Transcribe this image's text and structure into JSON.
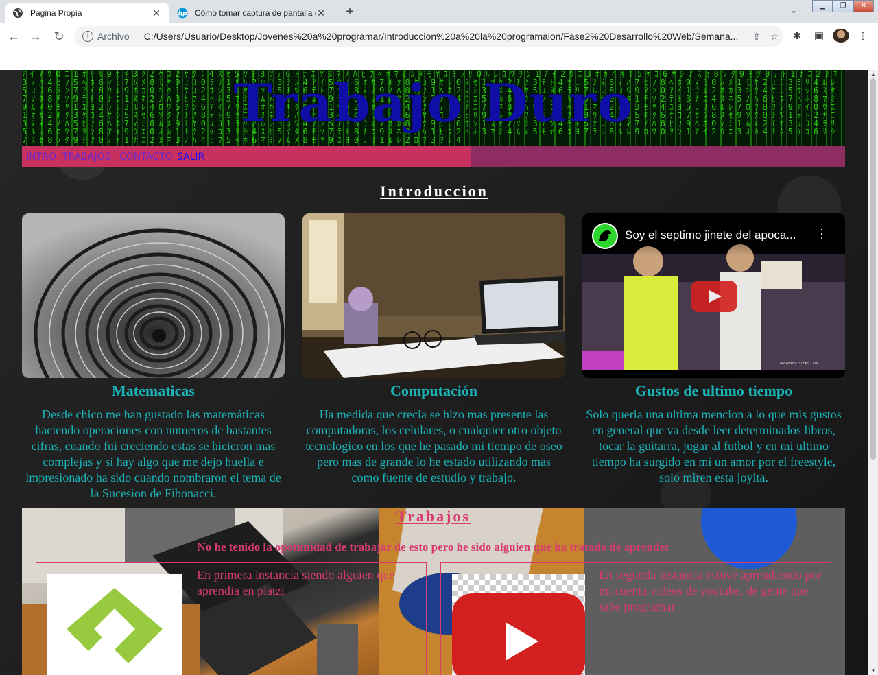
{
  "browser": {
    "tabs": [
      {
        "title": "Pagina Propia",
        "active": true
      },
      {
        "title": "Cómo tomar captura de pantalla (Sc",
        "active": false
      }
    ],
    "address_scheme": "Archivo",
    "address_url": "C:/Users/Usuario/Desktop/Jovenes%20a%20programar/Introduccion%20a%20la%20programaion/Fase2%20Desarrollo%20Web/Semana..."
  },
  "site": {
    "title": "Trabajo Duro",
    "menu": [
      "INTRO",
      "TRABAJOS",
      "CONTACTO",
      "SALIR"
    ]
  },
  "intro": {
    "heading": "Introduccion",
    "cards": [
      {
        "title": "Matematicas",
        "text": "Desde chico me han gustado las matemáticas haciendo operaciones con numeros de bastantes cifras, cuando fui creciendo estas se hicieron mas complejas y si hay algo que me dejo huella e impresionado ha sido cuando nombraron el tema de la Sucesion de Fibonacci."
      },
      {
        "title": "Computación",
        "text": "Ha medida que crecia se hizo mas presente las computadoras, los celulares, o cualquier otro objeto tecnologico en los que he pasado mi tiempo de oseo pero mas de grande lo he estado utilizando mas como fuente de estudio y trabajo."
      },
      {
        "title": "Gustos de ultimo tiempo",
        "text": "Solo queria una ultima mencion a lo que mis gustos en general que va desde leer determinados libros, tocar la guitarra, jugar al futbol y en mi ultimo tiempo ha surgido en mi un amor por el freestyle, solo miren esta joyita."
      }
    ],
    "video": {
      "title": "Soy el septimo jinete del apoca...",
      "watermark": "URBANROOSTERS.COM"
    }
  },
  "trabajos": {
    "heading": "Trabajos",
    "subtitle": "No he tenido la opotunidad de trabajar de esto pero he sido alguien que ha tratado de aprender",
    "items": [
      {
        "text": "En primera instancia siendo alguien que aprendia en platzi"
      },
      {
        "text": "En segunda instancia estuve aprendiendo por mi cuenta videos de youtube, de gente que sabe programar"
      }
    ]
  },
  "colors": {
    "accent_teal": "#19b3b8",
    "accent_pink": "#d83a73",
    "title_blue": "#0f0fa8"
  }
}
